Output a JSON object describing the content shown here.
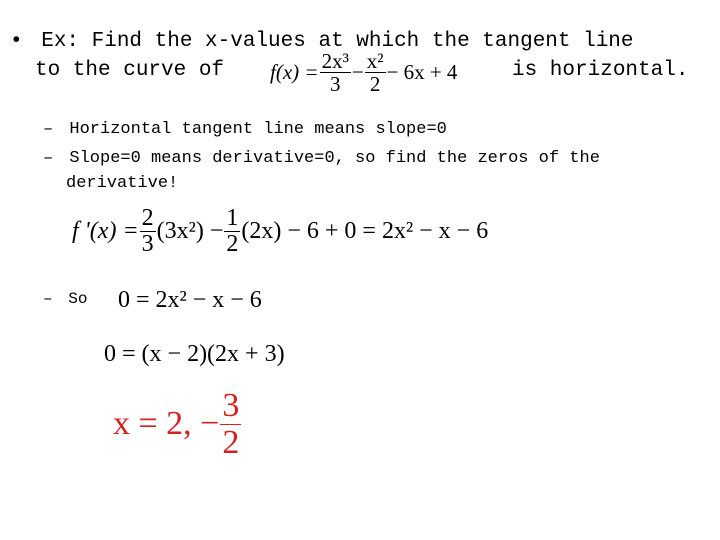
{
  "slide": {
    "bullet_marker": "•",
    "sub_marker": "–",
    "intro_line1": "Ex: Find the x-values at which the tangent line",
    "intro_line2_prefix": "to the curve of",
    "intro_line2_suffix": "is horizontal.",
    "function_expr": {
      "lhs": "f(x) =",
      "term1_num": "2x³",
      "term1_den": "3",
      "op1": "−",
      "term2_num": "x²",
      "term2_den": "2",
      "tail": "− 6x + 4"
    },
    "sub_bullets": [
      "Horizontal tangent line means slope=0",
      "Slope=0 means derivative=0, so find the zeros of the",
      "derivative!"
    ],
    "derivative_expr": {
      "lhs": "f '(x) =",
      "frac1_num": "2",
      "frac1_den": "3",
      "part1": "(3x²) −",
      "frac2_num": "1",
      "frac2_den": "2",
      "part2": "(2x) − 6 + 0 = 2x² − x − 6"
    },
    "so_label": "So",
    "equation1": "0 = 2x² − x − 6",
    "equation2": "0 = (x − 2)(2x + 3)",
    "answer": {
      "prefix": "x = 2, −",
      "frac_num": "3",
      "frac_den": "2",
      "color": "#d42020"
    }
  }
}
